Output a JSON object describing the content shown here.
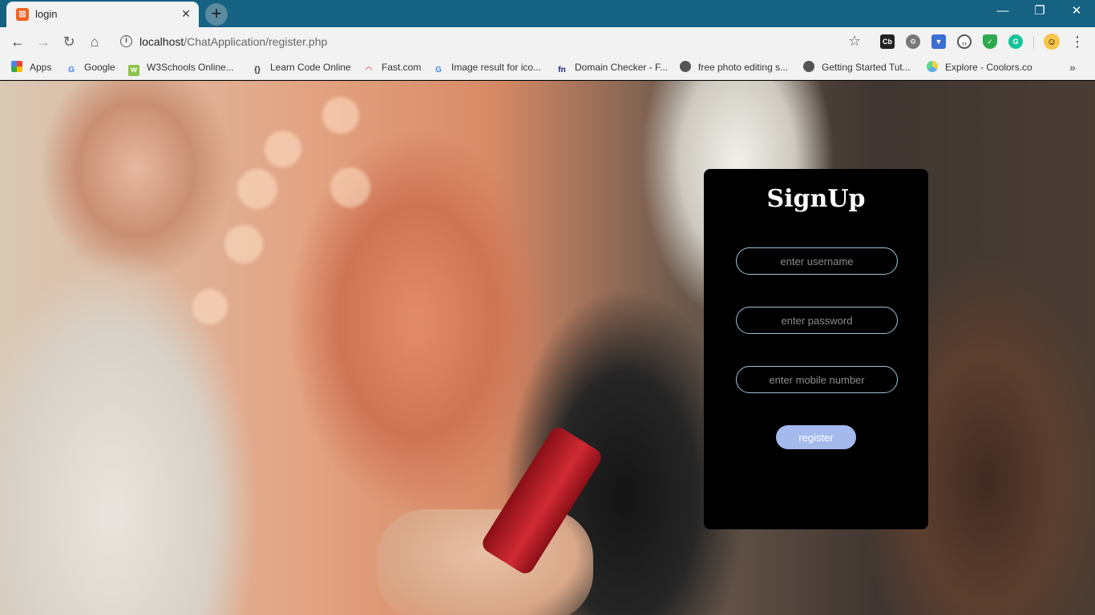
{
  "browser": {
    "tab": {
      "title": "login",
      "favicon": "xampp-icon",
      "close": "✕"
    },
    "new_tab": "+",
    "window_controls": {
      "minimize": "—",
      "maximize": "❐",
      "close": "✕"
    },
    "address": {
      "host": "localhost",
      "path": "/ChatApplication/register.php"
    },
    "extensions": [
      "cb",
      "gear",
      "save",
      "code",
      "shield",
      "grammarly"
    ],
    "bookmarks": [
      {
        "label": "Apps",
        "icon": "apps-grid-icon"
      },
      {
        "label": "Google",
        "icon": "google-icon"
      },
      {
        "label": "W3Schools Online...",
        "icon": "w3schools-icon"
      },
      {
        "label": "Learn Code Online",
        "icon": "learncode-icon"
      },
      {
        "label": "Fast.com",
        "icon": "fast-icon"
      },
      {
        "label": "Image result for ico...",
        "icon": "google-icon"
      },
      {
        "label": "Domain Checker - F...",
        "icon": "fn-icon"
      },
      {
        "label": "free photo editing s...",
        "icon": "globe-icon"
      },
      {
        "label": "Getting Started Tut...",
        "icon": "globe-icon"
      },
      {
        "label": "Explore - Coolors.co",
        "icon": "coolors-icon"
      }
    ],
    "more": "»"
  },
  "signup": {
    "title": "SignUp",
    "username_placeholder": "enter username",
    "password_placeholder": "enter password",
    "mobile_placeholder": "enter mobile number",
    "register_label": "register"
  },
  "colors": {
    "titlebar": "#156282",
    "card_bg": "#000000",
    "field_border": "#9cc6d8",
    "button_bg": "#a4b9ec"
  }
}
